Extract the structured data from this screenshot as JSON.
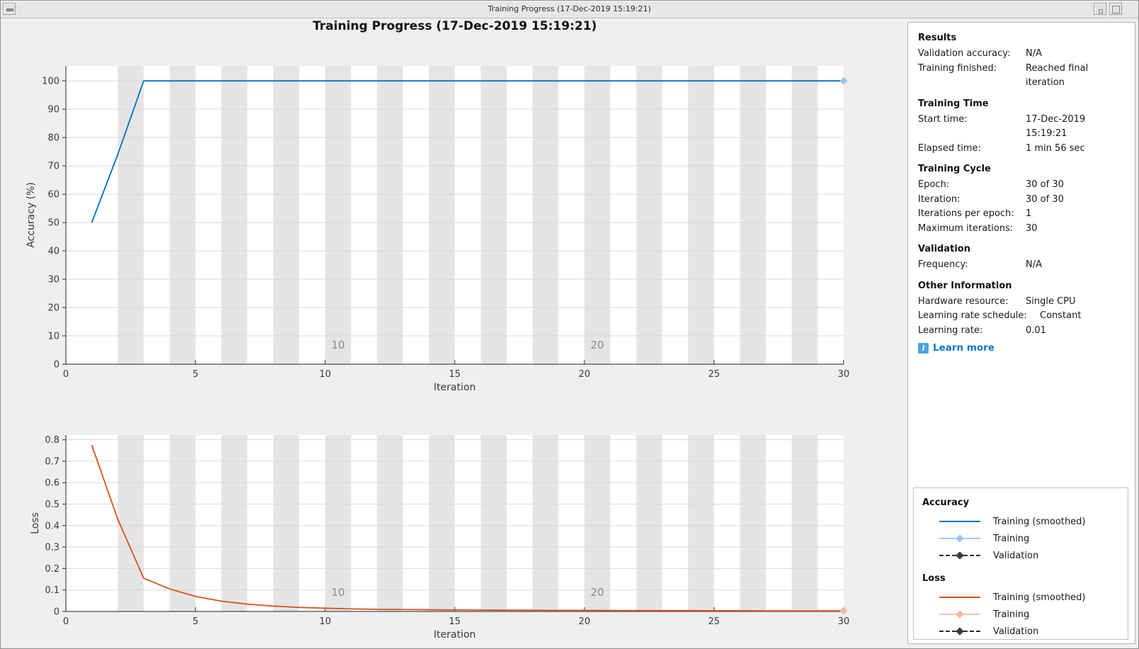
{
  "window": {
    "title": "Training Progress (17-Dec-2019 15:19:21)"
  },
  "chart_title": "Training Progress (17-Dec-2019 15:19:21)",
  "panel": {
    "sections": [
      {
        "heading": "Results",
        "rows": [
          {
            "label": "Validation accuracy:",
            "value": "N/A"
          },
          {
            "label": "Training finished:",
            "value": "Reached final iteration"
          }
        ]
      },
      {
        "heading": "Training Time",
        "rows": [
          {
            "label": "Start time:",
            "value": "17-Dec-2019 15:19:21"
          },
          {
            "label": "Elapsed time:",
            "value": "1 min 56 sec"
          }
        ]
      },
      {
        "heading": "Training Cycle",
        "rows": [
          {
            "label": "Epoch:",
            "value": "30 of 30"
          },
          {
            "label": "Iteration:",
            "value": "30 of 30"
          },
          {
            "label": "Iterations per epoch:",
            "value": "1"
          },
          {
            "label": "Maximum iterations:",
            "value": "30"
          }
        ]
      },
      {
        "heading": "Validation",
        "rows": [
          {
            "label": "Frequency:",
            "value": "N/A"
          }
        ]
      },
      {
        "heading": "Other Information",
        "rows": [
          {
            "label": "Hardware resource:",
            "value": "Single CPU"
          },
          {
            "label": "Learning rate schedule:",
            "value": "Constant"
          },
          {
            "label": "Learning rate:",
            "value": "0.01"
          }
        ]
      }
    ],
    "learn_more": "Learn more"
  },
  "legend": {
    "groups": [
      {
        "heading": "Accuracy",
        "entries": [
          {
            "label": "Training (smoothed)"
          },
          {
            "label": "Training"
          },
          {
            "label": "Validation"
          }
        ]
      },
      {
        "heading": "Loss",
        "entries": [
          {
            "label": "Training (smoothed)"
          },
          {
            "label": "Training"
          },
          {
            "label": "Validation"
          }
        ]
      }
    ]
  },
  "colors": {
    "band": "#e5e5e5",
    "grid": "#d9d9d9",
    "axis": "#4a4a4a",
    "tick_text": "#3a3a3a",
    "epoch_label": "#8a8a8a",
    "acc_smoothed": {
      "line": "#0072BD",
      "marker": "#0072BD"
    },
    "acc_raw": {
      "line": "#a8cee5",
      "marker": "#9cc6e4"
    },
    "loss_smoothed": {
      "line": "#D95319",
      "marker": "#D95319"
    },
    "loss_raw": {
      "line": "#f4c4ab",
      "marker": "#f0b79b"
    },
    "validation": {
      "line": "#2e2e2e",
      "marker": "#3a3a3a"
    },
    "link": "#0b76c4",
    "info_icon": "#4da3dd"
  },
  "chart_data": [
    {
      "type": "line",
      "ylabel": "Accuracy (%)",
      "xlabel": "Iteration",
      "xlim": [
        0,
        30
      ],
      "ylim": [
        0,
        105.3
      ],
      "xticks": [
        0,
        5,
        10,
        15,
        20,
        25,
        30
      ],
      "yticks": [
        0,
        10,
        20,
        30,
        40,
        50,
        60,
        70,
        80,
        90,
        100
      ],
      "grid": "horizontal",
      "legend_position": "outside-right-panel",
      "bands": [
        [
          2,
          3
        ],
        [
          4,
          5
        ],
        [
          6,
          7
        ],
        [
          8,
          9
        ],
        [
          10,
          11
        ],
        [
          12,
          13
        ],
        [
          14,
          15
        ],
        [
          16,
          17
        ],
        [
          18,
          19
        ],
        [
          20,
          21
        ],
        [
          22,
          23
        ],
        [
          24,
          25
        ],
        [
          26,
          27
        ],
        [
          28,
          29
        ]
      ],
      "epoch_labels": [
        {
          "text": "10",
          "x": 10.5
        },
        {
          "text": "20",
          "x": 20.5
        }
      ],
      "x": [
        1,
        2,
        3,
        4,
        5,
        6,
        7,
        8,
        9,
        10,
        11,
        12,
        13,
        14,
        15,
        16,
        17,
        18,
        19,
        20,
        21,
        22,
        23,
        24,
        25,
        26,
        27,
        28,
        29,
        30
      ],
      "series": [
        {
          "name": "Training (smoothed)",
          "color_key": "acc_smoothed",
          "values": [
            50,
            74,
            100,
            100,
            100,
            100,
            100,
            100,
            100,
            100,
            100,
            100,
            100,
            100,
            100,
            100,
            100,
            100,
            100,
            100,
            100,
            100,
            100,
            100,
            100,
            100,
            100,
            100,
            100,
            100
          ]
        },
        {
          "name": "Training",
          "color_key": "acc_raw",
          "end_marker": [
            30,
            100
          ]
        },
        {
          "name": "Validation",
          "color_key": "validation"
        }
      ]
    },
    {
      "type": "line",
      "ylabel": "Loss",
      "xlabel": "Iteration",
      "xlim": [
        0,
        30
      ],
      "ylim": [
        0,
        0.822
      ],
      "xticks": [
        0,
        5,
        10,
        15,
        20,
        25,
        30
      ],
      "yticks": [
        0,
        0.1,
        0.2,
        0.3,
        0.4,
        0.5,
        0.6,
        0.7,
        0.8
      ],
      "grid": "horizontal",
      "bands": [
        [
          2,
          3
        ],
        [
          4,
          5
        ],
        [
          6,
          7
        ],
        [
          8,
          9
        ],
        [
          10,
          11
        ],
        [
          12,
          13
        ],
        [
          14,
          15
        ],
        [
          16,
          17
        ],
        [
          18,
          19
        ],
        [
          20,
          21
        ],
        [
          22,
          23
        ],
        [
          24,
          25
        ],
        [
          26,
          27
        ],
        [
          28,
          29
        ]
      ],
      "epoch_labels": [
        {
          "text": "10",
          "x": 10.5
        },
        {
          "text": "20",
          "x": 20.5
        }
      ],
      "x": [
        1,
        2,
        3,
        4,
        5,
        6,
        7,
        8,
        9,
        10,
        11,
        12,
        13,
        14,
        15,
        16,
        17,
        18,
        19,
        20,
        21,
        22,
        23,
        24,
        25,
        26,
        27,
        28,
        29,
        30
      ],
      "series": [
        {
          "name": "Training (smoothed)",
          "color_key": "loss_smoothed",
          "values": [
            0.775,
            0.43,
            0.155,
            0.105,
            0.07,
            0.048,
            0.034,
            0.025,
            0.019,
            0.015,
            0.012,
            0.01,
            0.009,
            0.008,
            0.007,
            0.0065,
            0.006,
            0.0055,
            0.005,
            0.005,
            0.0045,
            0.004,
            0.004,
            0.004,
            0.0035,
            0.0035,
            0.003,
            0.003,
            0.003,
            0.003
          ]
        },
        {
          "name": "Training",
          "color_key": "loss_raw",
          "end_marker": [
            30,
            0.003
          ]
        },
        {
          "name": "Validation",
          "color_key": "validation"
        }
      ]
    }
  ]
}
